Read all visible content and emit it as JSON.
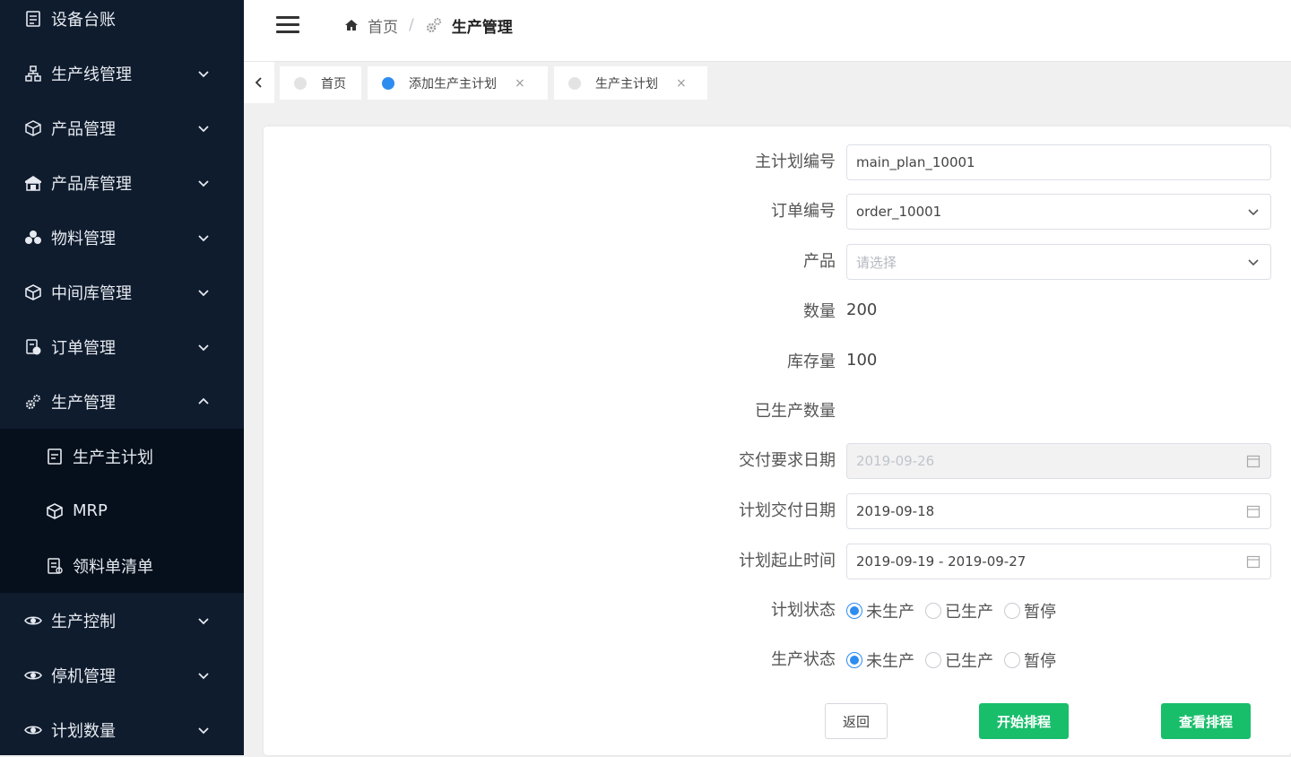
{
  "sidebar": {
    "top_item": {
      "label": "设备台账",
      "icon": "ledger-icon"
    },
    "items": [
      {
        "label": "生产线管理",
        "icon": "sitemap-icon"
      },
      {
        "label": "产品管理",
        "icon": "product-box-icon"
      },
      {
        "label": "产品库管理",
        "icon": "warehouse-icon"
      },
      {
        "label": "物料管理",
        "icon": "materials-icon"
      },
      {
        "label": "中间库管理",
        "icon": "cube-icon"
      },
      {
        "label": "订单管理",
        "icon": "order-icon"
      },
      {
        "label": "生产管理",
        "icon": "gears-icon"
      }
    ],
    "submenu": [
      {
        "label": "生产主计划",
        "icon": "plan-doc-icon"
      },
      {
        "label": "MRP",
        "icon": "mrp-cube-icon"
      },
      {
        "label": "领料单清单",
        "icon": "requisition-list-icon"
      }
    ],
    "bottom_items": [
      {
        "label": "生产控制",
        "icon": "control-eye-icon"
      },
      {
        "label": "停机管理",
        "icon": "stop-eye-icon"
      },
      {
        "label": "计划数量",
        "icon": "quantity-eye-icon"
      }
    ]
  },
  "header": {
    "breadcrumb_home": "首页",
    "breadcrumb_sep": "/",
    "breadcrumb_current": "生产管理"
  },
  "tabs": [
    {
      "label": "首页",
      "active": false,
      "closable": false
    },
    {
      "label": "添加生产主计划",
      "active": true,
      "closable": true
    },
    {
      "label": "生产主计划",
      "active": false,
      "closable": true
    }
  ],
  "tab_close_glyph": "×",
  "form": {
    "plan_no": {
      "label": "主计划编号",
      "value": "main_plan_10001"
    },
    "order_no": {
      "label": "订单编号",
      "value": "order_10001"
    },
    "product": {
      "label": "产品",
      "placeholder": "请选择"
    },
    "quantity": {
      "label": "数量",
      "value": "200"
    },
    "stock": {
      "label": "库存量",
      "value": "100"
    },
    "produced": {
      "label": "已生产数量",
      "value": ""
    },
    "required_date": {
      "label": "交付要求日期",
      "value": "2019-09-26"
    },
    "planned_date": {
      "label": "计划交付日期",
      "value": "2019-09-18"
    },
    "plan_range": {
      "label": "计划起止时间",
      "value": "2019-09-19 - 2019-09-27"
    },
    "plan_status": {
      "label": "计划状态",
      "options": [
        "未生产",
        "已生产",
        "暂停"
      ],
      "selected": "未生产"
    },
    "prod_status": {
      "label": "生产状态",
      "options": [
        "未生产",
        "已生产",
        "暂停"
      ],
      "selected": "未生产"
    }
  },
  "buttons": {
    "back": "返回",
    "start": "开始排程",
    "view": "查看排程"
  },
  "colors": {
    "sidebar_bg": "#0f1c2e",
    "submenu_bg": "#06101c",
    "primary": "#2d8cf0",
    "success": "#19be6b"
  }
}
